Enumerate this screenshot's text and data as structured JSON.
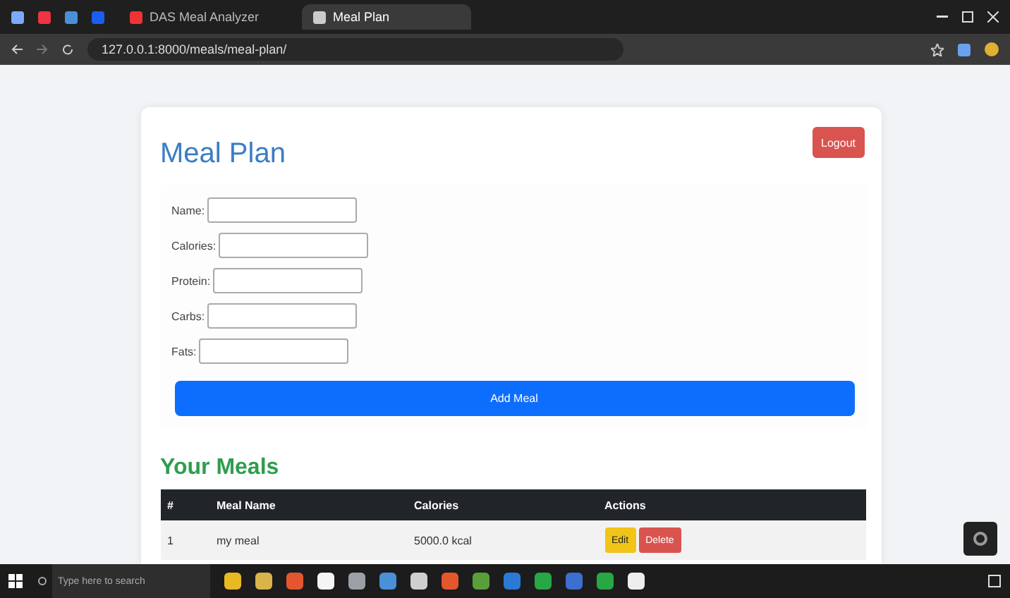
{
  "browser": {
    "tabs": [
      {
        "label": "DAS Meal Analyzer",
        "selected": false
      },
      {
        "label": "Meal Plan",
        "selected": true
      }
    ],
    "address": "127.0.0.1:8000/meals/meal-plan/"
  },
  "page": {
    "title": "Meal Plan",
    "logout": "Logout",
    "form": {
      "fields": [
        {
          "label": "Name:"
        },
        {
          "label": "Calories:"
        },
        {
          "label": "Protein:"
        },
        {
          "label": "Carbs:"
        },
        {
          "label": "Fats:"
        }
      ],
      "submit": "Add Meal"
    },
    "meals_title": "Your Meals",
    "table": {
      "columns": [
        "#",
        "Meal Name",
        "Calories",
        "Actions"
      ],
      "rows": [
        {
          "index": "1",
          "name": "my meal",
          "calories": "5000.0 kcal",
          "actions": [
            "Edit",
            "Delete"
          ]
        }
      ]
    }
  },
  "taskbar": {
    "search": {
      "placeholder": "Type here to search"
    }
  }
}
